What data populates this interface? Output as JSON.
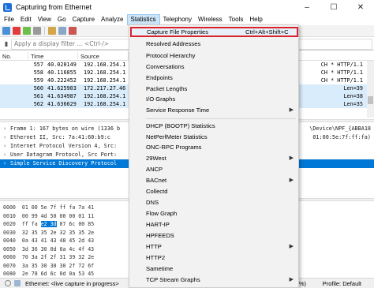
{
  "window": {
    "title": "Capturing from Ethernet",
    "controls": [
      "–",
      "☐",
      "✕"
    ]
  },
  "menubar": [
    "File",
    "Edit",
    "View",
    "Go",
    "Capture",
    "Analyze",
    "Statistics",
    "Telephony",
    "Wireless",
    "Tools",
    "Help"
  ],
  "filter": {
    "placeholder": "Apply a display filter ... <Ctrl-/>"
  },
  "packet_list": {
    "columns": [
      "No.",
      "Time",
      "Source"
    ],
    "rows": [
      {
        "no": "557",
        "time": "40.020149",
        "src": "192.168.254.1",
        "info": "CH * HTTP/1.1"
      },
      {
        "no": "558",
        "time": "40.116855",
        "src": "192.168.254.1",
        "info": "CH * HTTP/1.1"
      },
      {
        "no": "559",
        "time": "40.222452",
        "src": "192.168.254.1",
        "info": "CH * HTTP/1.1"
      },
      {
        "no": "560",
        "time": "41.625903",
        "src": "172.217.27.46",
        "info": "Len=39"
      },
      {
        "no": "561",
        "time": "41.634987",
        "src": "192.168.254.1",
        "info": "Len=38"
      },
      {
        "no": "562",
        "time": "41.636629",
        "src": "192.168.254.1",
        "info": "Len=35"
      }
    ]
  },
  "details": [
    {
      "text": "Frame 1: 167 bytes on wire (1336 b",
      "right": "\\Device\\NPF_{ABBA18"
    },
    {
      "text": "Ethernet II, Src: 7a:41:60:b9:c",
      "right": "01:00:5e:7f:ff:fa)"
    },
    {
      "text": "Internet Protocol Version 4, Src:",
      "right": ""
    },
    {
      "text": "User Datagram Protocol, Src Port:",
      "right": ""
    },
    {
      "text": "Simple Service Discovery Protocol",
      "right": ""
    }
  ],
  "bytes": [
    {
      "off": "0000",
      "hex": "01 00 5e 7f ff fa 7a 41",
      "ascii": ""
    },
    {
      "off": "0010",
      "hex": "00 99 4d 50 00 00 01 11",
      "ascii": ""
    },
    {
      "off": "0020",
      "pre": "ff fa ",
      "sel": "e2 3d",
      "post": " 07 6c 00 85",
      "ascii": ""
    },
    {
      "off": "0030",
      "hex": "32 35 35 2e 32 35 35 2e",
      "ascii": ""
    },
    {
      "off": "0040",
      "hex": "0a 43 41 43 48 45 2d 43",
      "ascii": ""
    },
    {
      "off": "0050",
      "hex": "3d 36 30 0d 0a 4c 4f 43",
      "ascii": ""
    },
    {
      "off": "0060",
      "hex": "70 3a 2f 2f 31 39 32 2e",
      "ascii": ""
    },
    {
      "off": "0070",
      "hex": "3a 35 30 30 30 2f 72 6f",
      "ascii": ""
    },
    {
      "off": "0080",
      "hex": "2e 78 6d 6c 0d 0a 53 45",
      "ascii": ""
    }
  ],
  "status": {
    "text": "Ethernet: <live capture in progress>",
    "mid": "(100.0%)",
    "profile": "Profile: Default"
  },
  "statistics_menu": [
    {
      "label": "Capture File Properties",
      "shortcut": "Ctrl+Alt+Shift+C",
      "highlight": true
    },
    {
      "label": "Resolved Addresses"
    },
    {
      "label": "Protocol Hierarchy"
    },
    {
      "label": "Conversations"
    },
    {
      "label": "Endpoints"
    },
    {
      "label": "Packet Lengths"
    },
    {
      "label": "I/O Graphs"
    },
    {
      "label": "Service Response Time",
      "submenu": true
    },
    {
      "label": "DHCP (BOOTP) Statistics"
    },
    {
      "label": "NetPerfMeter Statistics"
    },
    {
      "label": "ONC-RPC Programs"
    },
    {
      "label": "29West",
      "submenu": true
    },
    {
      "label": "ANCP"
    },
    {
      "label": "BACnet",
      "submenu": true
    },
    {
      "label": "Collectd"
    },
    {
      "label": "DNS"
    },
    {
      "label": "Flow Graph"
    },
    {
      "label": "HART-IP"
    },
    {
      "label": "HPFEEDS"
    },
    {
      "label": "HTTP",
      "submenu": true
    },
    {
      "label": "HTTP2"
    },
    {
      "label": "Sametime"
    },
    {
      "label": "TCP Stream Graphs",
      "submenu": true
    }
  ],
  "colors": {
    "menu_highlight_border": "#d9232a",
    "selection": "#0078d7",
    "row_alt": "#d9ecfb"
  }
}
